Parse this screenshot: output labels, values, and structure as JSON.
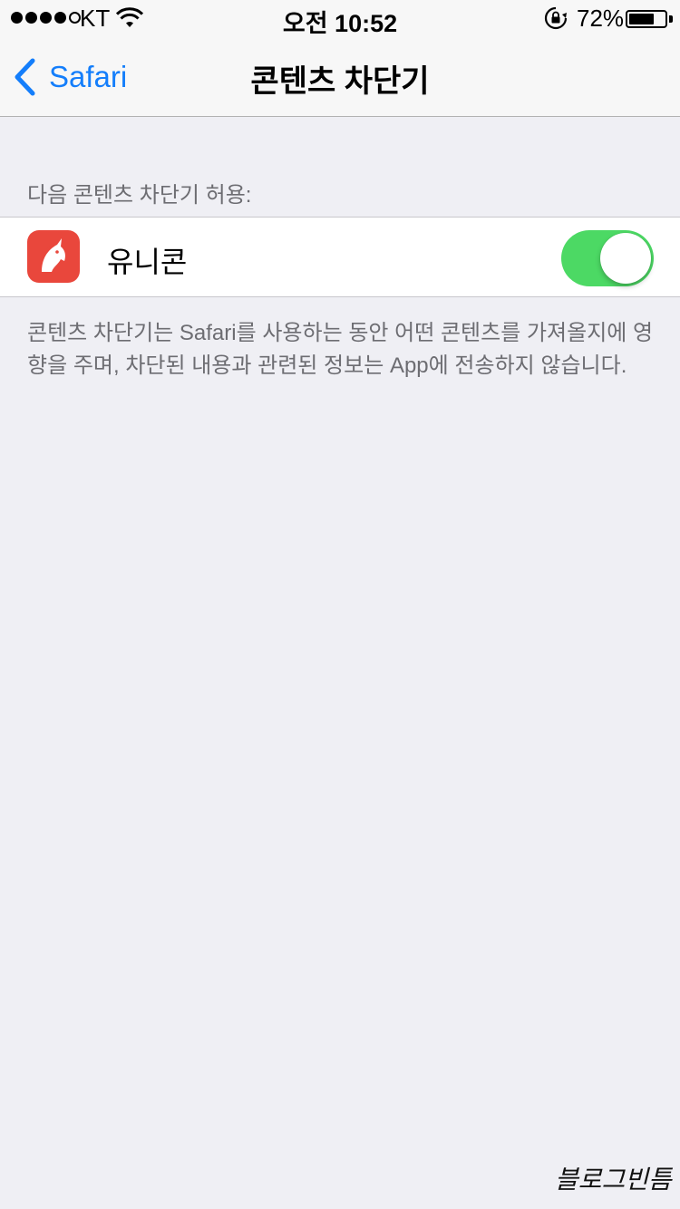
{
  "status_bar": {
    "carrier": "KT",
    "time": "오전 10:52",
    "battery_percent": "72%",
    "battery_level": 0.72,
    "signal_bars_filled": 4,
    "signal_bars_total": 5,
    "icons": [
      "signal-dots-icon",
      "wifi-icon",
      "rotation-lock-icon",
      "battery-icon"
    ]
  },
  "nav": {
    "back_label": "Safari",
    "title": "콘텐츠 차단기",
    "accent_color": "#147efb"
  },
  "section": {
    "header": "다음 콘텐츠 차단기 허용:",
    "items": [
      {
        "label": "유니콘",
        "icon": "unicorn-app-icon",
        "icon_color": "#e9473c",
        "enabled": true,
        "toggle_color": "#4cd964"
      }
    ],
    "footer": "콘텐츠 차단기는 Safari를 사용하는 동안 어떤 콘텐츠를 가져올지에 영향을 주며, 차단된 내용과 관련된 정보는 App에 전송하지 않습니다."
  },
  "watermark": "블로그빈틈"
}
